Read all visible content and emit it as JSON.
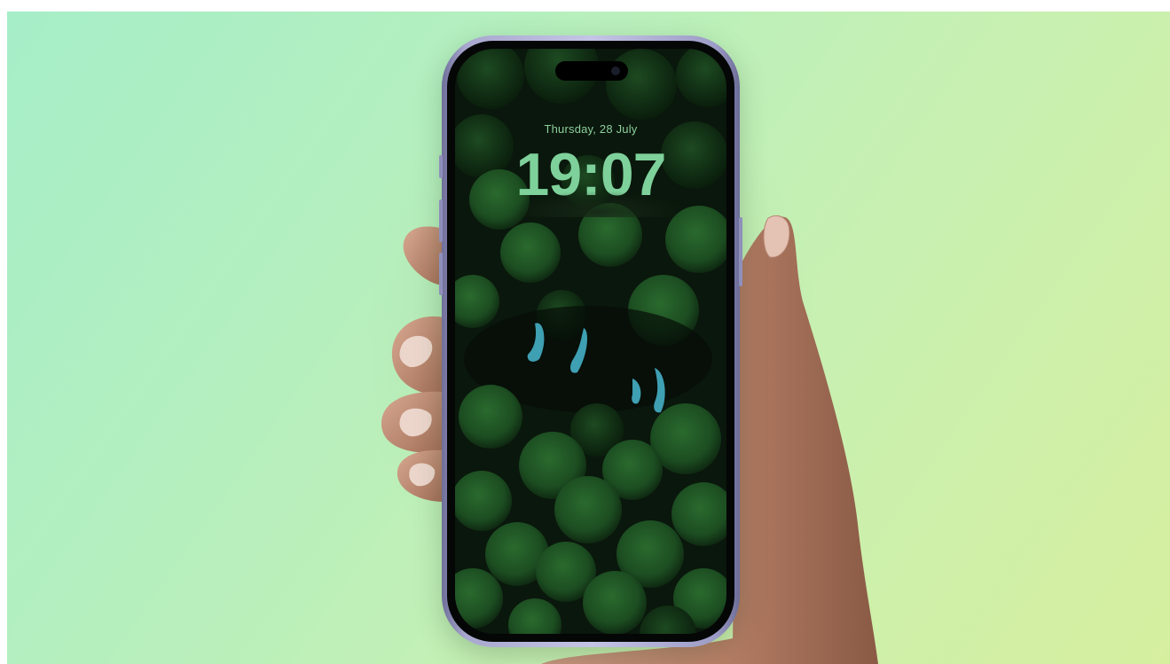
{
  "lock_screen": {
    "date": "Thursday, 28 July",
    "time": "19:07"
  },
  "colors": {
    "background_gradient": [
      "#a6eec8",
      "#c6f0b3",
      "#d6ef9f"
    ],
    "phone_frame": "#b4b4db",
    "clock_text": "#7ed19a",
    "wallpaper_bubbles": "#1e5a26"
  },
  "icons": [
    "iphone-device",
    "dynamic-island",
    "front-camera-icon",
    "hand-image",
    "clownfish-wallpaper"
  ]
}
